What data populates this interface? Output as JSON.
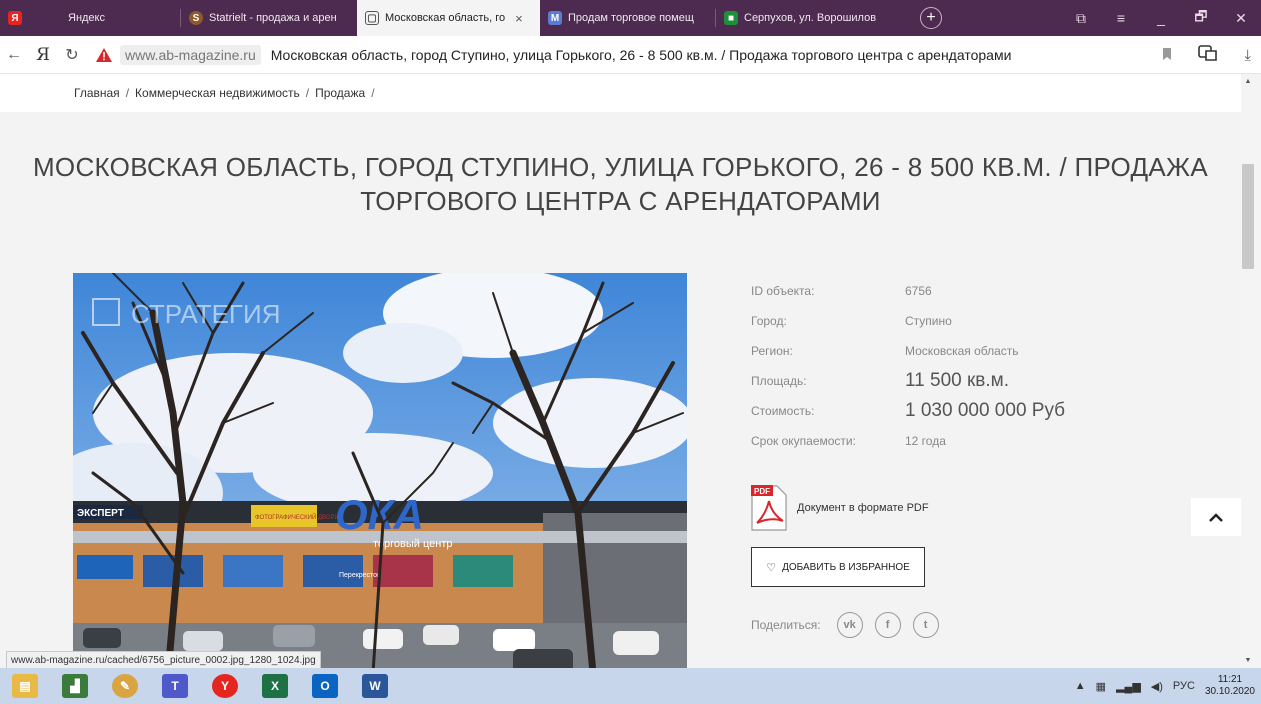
{
  "browser": {
    "tabs": [
      {
        "label": "Яндекс",
        "icon": "yandex-icon"
      },
      {
        "label": "Statrielt - продажа и арен",
        "icon": "statrielt-icon"
      },
      {
        "label": "Московская область, го",
        "icon": "page-icon",
        "active": true,
        "close": "×"
      },
      {
        "label": "Продам торговое помещ",
        "icon": "avito-icon"
      },
      {
        "label": "Серпухов, ул. Ворошилов",
        "icon": "cian-icon"
      }
    ],
    "new_tab": "+",
    "window_controls": [
      "⧉",
      "≡",
      "_",
      "🗗",
      "✕"
    ],
    "address": {
      "yandex_letter": "Я",
      "domain": "www.ab-magazine.ru",
      "page_title": "Московская область, город Ступино, улица Горького, 26 - 8 500 кв.м. / Продажа торгового центра с арендаторами"
    }
  },
  "breadcrumb": {
    "items": [
      "Главная",
      "Коммерческая недвижимость",
      "Продажа"
    ],
    "separator": "/"
  },
  "heading": "МОСКОВСКАЯ ОБЛАСТЬ, ГОРОД СТУПИНО, УЛИЦА ГОРЬКОГО, 26 - 8 500 КВ.М. / ПРОДАЖА ТОРГОВОГО ЦЕНТРА С АРЕНДАТОРАМИ",
  "photo": {
    "watermark": "СТРАТЕГИЯ",
    "signs": [
      "ЭКСПЕРТ",
      "ФОТОГРАФИЧЕСКИЙ ДВОРИК",
      "ОКА",
      "торговый центр",
      "Перекресток"
    ]
  },
  "properties": [
    {
      "label": "ID объекта:",
      "value": "6756",
      "big": false
    },
    {
      "label": "Город:",
      "value": "Ступино",
      "big": false
    },
    {
      "label": "Регион:",
      "value": "Московская область",
      "big": false
    },
    {
      "label": "Площадь:",
      "value": "11 500 кв.м.",
      "big": true
    },
    {
      "label": "Стоимость:",
      "value": "1 030 000 000 Руб",
      "big": true
    },
    {
      "label": "Срок окупаемости:",
      "value": "12 года",
      "big": false
    }
  ],
  "pdf": {
    "badge": "PDF",
    "label": "Документ в формате PDF"
  },
  "favorite_button": "ДОБАВИТЬ В ИЗБРАННОЕ",
  "share": {
    "label": "Поделиться:",
    "networks": [
      "vk",
      "f",
      "t"
    ]
  },
  "status_link": "www.ab-magazine.ru/cached/6756_picture_0002.jpg_1280_1024.jpg",
  "taskbar": {
    "apps": [
      "file-explorer",
      "analytics",
      "paint",
      "teams",
      "yandex-browser",
      "excel",
      "outlook",
      "word"
    ],
    "tray_lang": "РУС",
    "time": "11:21",
    "date": "30.10.2020"
  },
  "colors": {
    "tabbar": "#4d2a4f",
    "page_bg": "#f3f3f3",
    "taskbar": "#c7d6ea"
  }
}
